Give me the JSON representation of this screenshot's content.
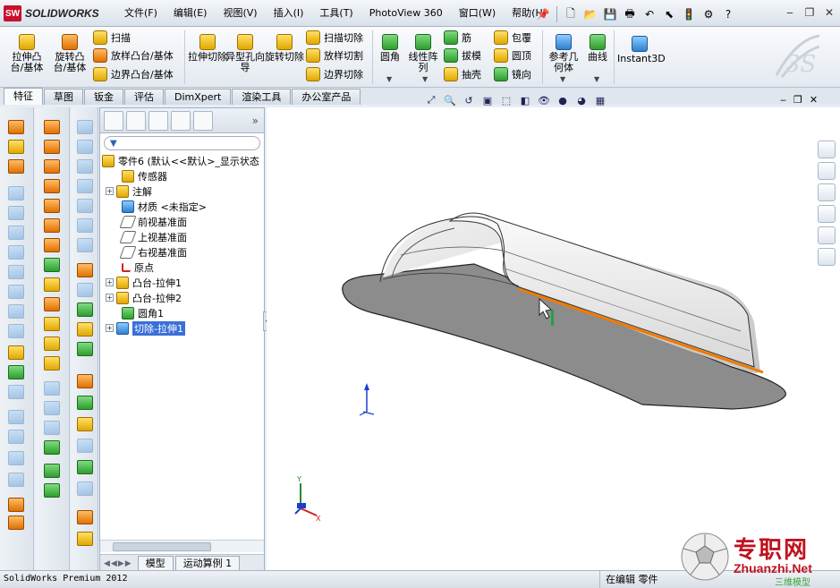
{
  "app": {
    "logo_text": "SOLIDWORKS",
    "logo_badge": "SW",
    "status_product": "SolidWorks Premium 2012",
    "status_mode": "在编辑 零件"
  },
  "menu": [
    "文件(F)",
    "编辑(E)",
    "视图(V)",
    "插入(I)",
    "工具(T)",
    "PhotoView 360",
    "窗口(W)",
    "帮助(H)"
  ],
  "quick_toolbar": [
    "new-doc",
    "open",
    "save",
    "print",
    "undo",
    "select",
    "rebuild",
    "options",
    "help"
  ],
  "command_manager": {
    "large": [
      {
        "label": "拉伸凸台/基体",
        "icon": "extrude-boss-icon"
      },
      {
        "label": "旋转凸台/基体",
        "icon": "revolve-boss-icon"
      },
      {
        "label": "拉伸切除",
        "icon": "extrude-cut-icon"
      },
      {
        "label": "异型孔向导",
        "icon": "hole-wizard-icon"
      },
      {
        "label": "旋转切除",
        "icon": "revolve-cut-icon"
      },
      {
        "label": "圆角",
        "icon": "fillet-icon"
      },
      {
        "label": "线性阵列",
        "icon": "linear-pattern-icon"
      },
      {
        "label": "参考几何体",
        "icon": "reference-geometry-icon"
      },
      {
        "label": "曲线",
        "icon": "curves-icon"
      },
      {
        "label": "Instant3D",
        "icon": "instant3d-icon"
      }
    ],
    "small": [
      {
        "label": "扫描",
        "icon": "sweep-icon"
      },
      {
        "label": "放样凸台/基体",
        "icon": "loft-icon"
      },
      {
        "label": "边界凸台/基体",
        "icon": "boundary-boss-icon"
      },
      {
        "label": "扫描切除",
        "icon": "swept-cut-icon"
      },
      {
        "label": "放样切割",
        "icon": "lofted-cut-icon"
      },
      {
        "label": "边界切除",
        "icon": "boundary-cut-icon"
      },
      {
        "label": "筋",
        "icon": "rib-icon"
      },
      {
        "label": "拔模",
        "icon": "draft-icon"
      },
      {
        "label": "抽壳",
        "icon": "shell-icon"
      },
      {
        "label": "包覆",
        "icon": "wrap-icon"
      },
      {
        "label": "圆顶",
        "icon": "dome-icon"
      },
      {
        "label": "镜向",
        "icon": "mirror-icon"
      }
    ]
  },
  "tabs": [
    "特征",
    "草图",
    "钣金",
    "评估",
    "DimXpert",
    "渲染工具",
    "办公室产品"
  ],
  "feature_tree": {
    "root": "零件6 (默认<<默认>_显示状态",
    "items": [
      {
        "label": "传感器",
        "expandable": false,
        "icon": "sensor-icon",
        "selected": false
      },
      {
        "label": "注解",
        "expandable": true,
        "icon": "annotations-icon",
        "selected": false
      },
      {
        "label": "材质 <未指定>",
        "expandable": false,
        "icon": "material-icon",
        "selected": false
      },
      {
        "label": "前视基准面",
        "expandable": false,
        "icon": "plane-icon",
        "selected": false
      },
      {
        "label": "上视基准面",
        "expandable": false,
        "icon": "plane-icon",
        "selected": false
      },
      {
        "label": "右视基准面",
        "expandable": false,
        "icon": "plane-icon",
        "selected": false
      },
      {
        "label": "原点",
        "expandable": false,
        "icon": "origin-icon",
        "selected": false
      },
      {
        "label": "凸台-拉伸1",
        "expandable": true,
        "icon": "extrude-icon",
        "selected": false
      },
      {
        "label": "凸台-拉伸2",
        "expandable": true,
        "icon": "extrude-icon",
        "selected": false
      },
      {
        "label": "圆角1",
        "expandable": false,
        "icon": "fillet-icon",
        "selected": false
      },
      {
        "label": "切除-拉伸1",
        "expandable": true,
        "icon": "cut-extrude-icon",
        "selected": true
      }
    ]
  },
  "bottom_tabs": [
    "模型",
    "运动算例 1"
  ],
  "watermark": {
    "title": "专职网",
    "url": "Zhuanzhi.Net",
    "sub": "三维模型"
  },
  "colors": {
    "accent": "#3a6fd8",
    "edge_highlight": "#f07a00",
    "body_fill": "#8c8c8c",
    "brand_red": "#c8102e"
  }
}
